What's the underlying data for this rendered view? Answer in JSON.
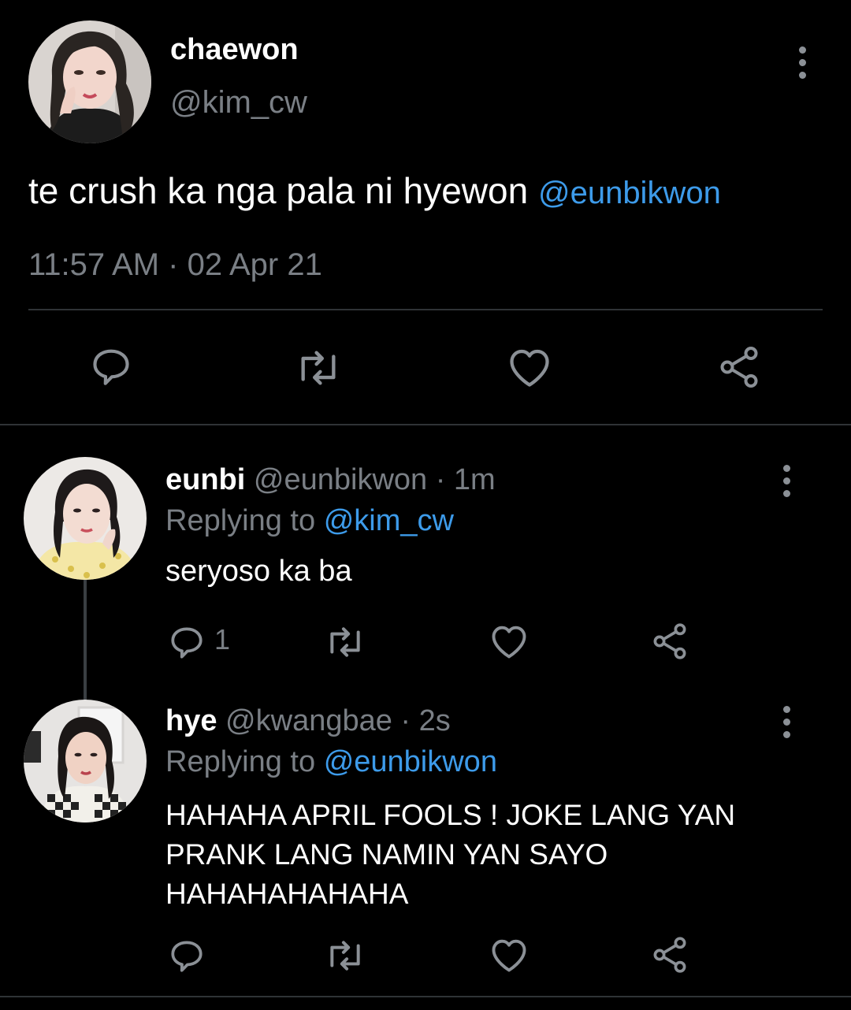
{
  "main_tweet": {
    "display_name": "chaewon",
    "handle": "@kim_cw",
    "text": "te crush ka nga pala ni hyewon",
    "mention": "@eunbikwon",
    "timestamp": "11:57 AM · 02 Apr 21",
    "avatar_icon": "profile-photo-avatar"
  },
  "replies": [
    {
      "display_name": "eunbi",
      "meta": "@eunbikwon · 1m",
      "replying_label": "Replying to",
      "replying_to": "@kim_cw",
      "text": "seryoso ka ba",
      "reply_count": "1"
    },
    {
      "display_name": "hye",
      "meta": "@kwangbae · 2s",
      "replying_label": "Replying to",
      "replying_to": "@eunbikwon",
      "text": "HAHAHA APRIL FOOLS ! JOKE LANG YAN PRANK LANG NAMIN YAN SAYO HAHAHAHAHAHA",
      "reply_count": ""
    }
  ],
  "icons": [
    "reply-icon",
    "retweet-icon",
    "like-icon",
    "share-icon",
    "more-options-icon"
  ],
  "colors": {
    "background": "#000000",
    "text": "#ffffff",
    "muted": "#7a7f85",
    "link": "#3d9bea",
    "icon": "#8b9096",
    "divider": "#2f3336"
  }
}
